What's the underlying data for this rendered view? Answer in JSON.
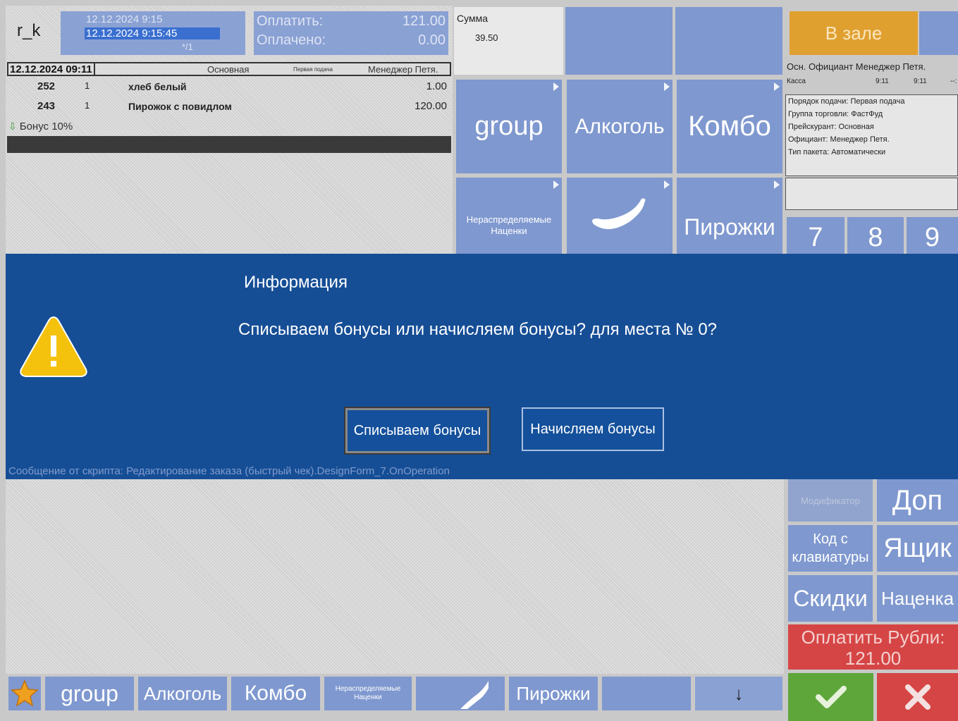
{
  "header": {
    "logo": "r_k",
    "date_line1": "12.12.2024 9:15",
    "date_line2": "12.12.2024 9:15:45",
    "date_line3": "*/1",
    "pay_label": "Оплатить:",
    "pay_value": "121.00",
    "paid_label": "Оплачено:",
    "paid_value": "0.00",
    "sum_label": "Сумма",
    "sum_value": "39.50"
  },
  "order": {
    "header_date": "12.12.2024 09:11",
    "header_menu": "Основная",
    "header_course": "Первая подача",
    "header_waiter": "Менеджер Петя.",
    "items": [
      {
        "code": "252",
        "qty": "1",
        "name": "хлеб белый",
        "price": "1.00"
      },
      {
        "code": "243",
        "qty": "1",
        "name": "Пирожок с повидлом",
        "price": "120.00"
      }
    ],
    "bonus": "Бонус 10%"
  },
  "tiles": {
    "group": "group",
    "alcohol": "Алкоголь",
    "combo": "Комбо",
    "unallocated": "Нераспределяемые Наценки",
    "pies": "Пирожки"
  },
  "right": {
    "hall_button": "В зале",
    "waiter_header": "Осн. Официант  Менеджер Петя.",
    "kassa_label": "Касса",
    "time1": "9:11",
    "time2": "9:11",
    "time3": "--:",
    "info_lines": [
      "Порядок подачи: Первая подача",
      "Группа торговли: ФастФуд",
      "Прейскурант: Основная",
      "Официант: Менеджер Петя.",
      "Тип пакета: Автоматически"
    ],
    "keys": [
      "7",
      "8",
      "9"
    ]
  },
  "dialog": {
    "title": "Информация",
    "message": "Списываем бонусы или начисляем бонусы? для места № 0?",
    "btn_writeoff": "Списываем бонусы",
    "btn_accrue": "Начисляем бонусы",
    "footer": "Сообщение от скрипта: Редактирование заказа (быстрый чек).DesignForm_7.OnOperation"
  },
  "actions": {
    "modifiers": "Модификатор",
    "extra": "Доп",
    "keyboard_code": "Код с клавиатуры",
    "drawer": "Ящик",
    "discounts": "Скидки",
    "markup": "Наценка",
    "pay_rub_label": "Оплатить Рубли:",
    "pay_rub_value": "121.00"
  },
  "bottom_bar": {
    "group": "group",
    "alcohol": "Алкоголь",
    "combo": "Комбо",
    "unallocated": "Нераспределяемые Наценки",
    "pies": "Пирожки",
    "down_arrow": "↓"
  },
  "colors": {
    "tile": "#7f98cf",
    "dialog": "#164e96",
    "hall": "#e0a030",
    "pay": "#d64545",
    "ok": "#5ea63a",
    "cancel": "#d64545"
  }
}
